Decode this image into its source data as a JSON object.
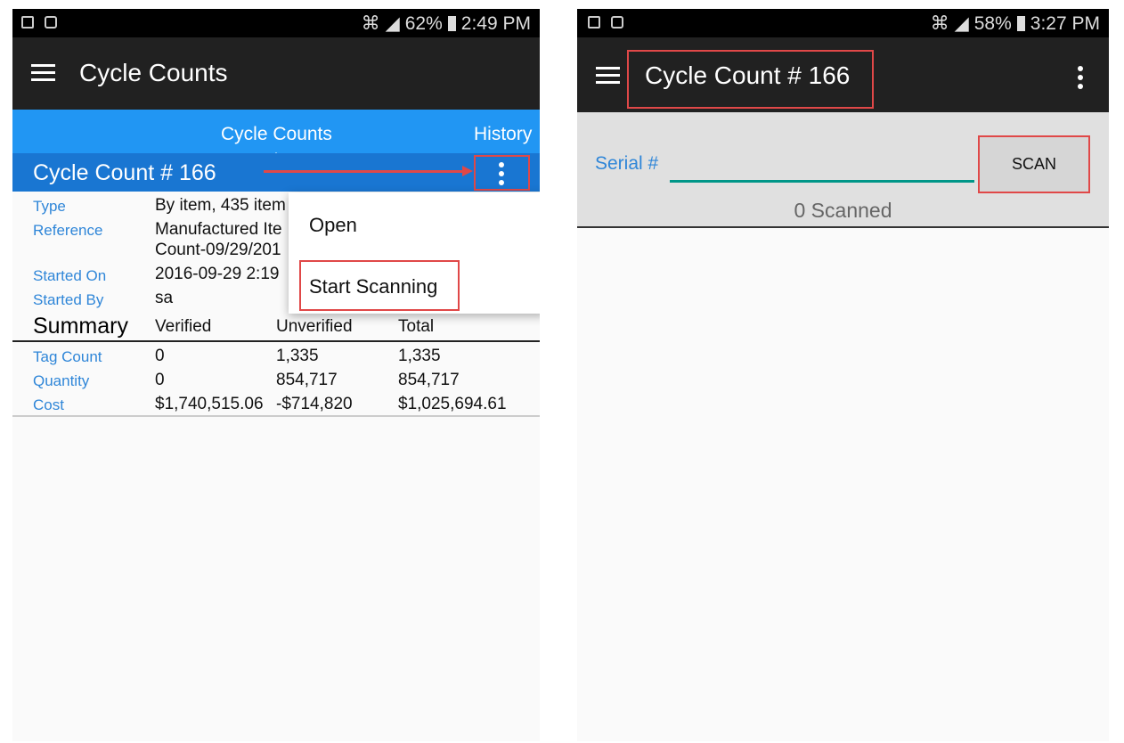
{
  "left": {
    "status": {
      "battery": "62%",
      "time": "2:49 PM"
    },
    "app_title": "Cycle Counts",
    "tabs": [
      {
        "label": "Cycle Counts",
        "active": true
      },
      {
        "label": "History",
        "active": false
      }
    ],
    "card_title": "Cycle Count # 166",
    "details": [
      {
        "label": "Type",
        "value": "By item, 435 item"
      },
      {
        "label": "Reference",
        "value": "Manufactured Ite",
        "value2": "Count-09/29/201"
      },
      {
        "label": "Started On",
        "value": "2016-09-29 2:19"
      },
      {
        "label": "Started By",
        "value": "sa"
      }
    ],
    "summary": {
      "title": "Summary",
      "columns": [
        "Verified",
        "Unverified",
        "Total"
      ],
      "rows": [
        {
          "label": "Tag Count",
          "values": [
            "0",
            "1,335",
            "1,335"
          ]
        },
        {
          "label": "Quantity",
          "values": [
            "0",
            "854,717",
            "854,717"
          ]
        },
        {
          "label": "Cost",
          "values": [
            "$1,740,515.06",
            "-$714,820",
            "$1,025,694.61"
          ]
        }
      ]
    },
    "menu": [
      "Open",
      "Start Scanning"
    ]
  },
  "right": {
    "status": {
      "battery": "58%",
      "time": "3:27 PM"
    },
    "app_title": "Cycle Count # 166",
    "serial_label": "Serial #",
    "serial_value": "",
    "scan_label": "SCAN",
    "scanned_text": "0 Scanned"
  },
  "colors": {
    "tab_bar": "#2196f3",
    "card_header": "#1976d2",
    "annotation": "#e04848",
    "input_underline": "#009688",
    "label": "#2f86d8"
  }
}
